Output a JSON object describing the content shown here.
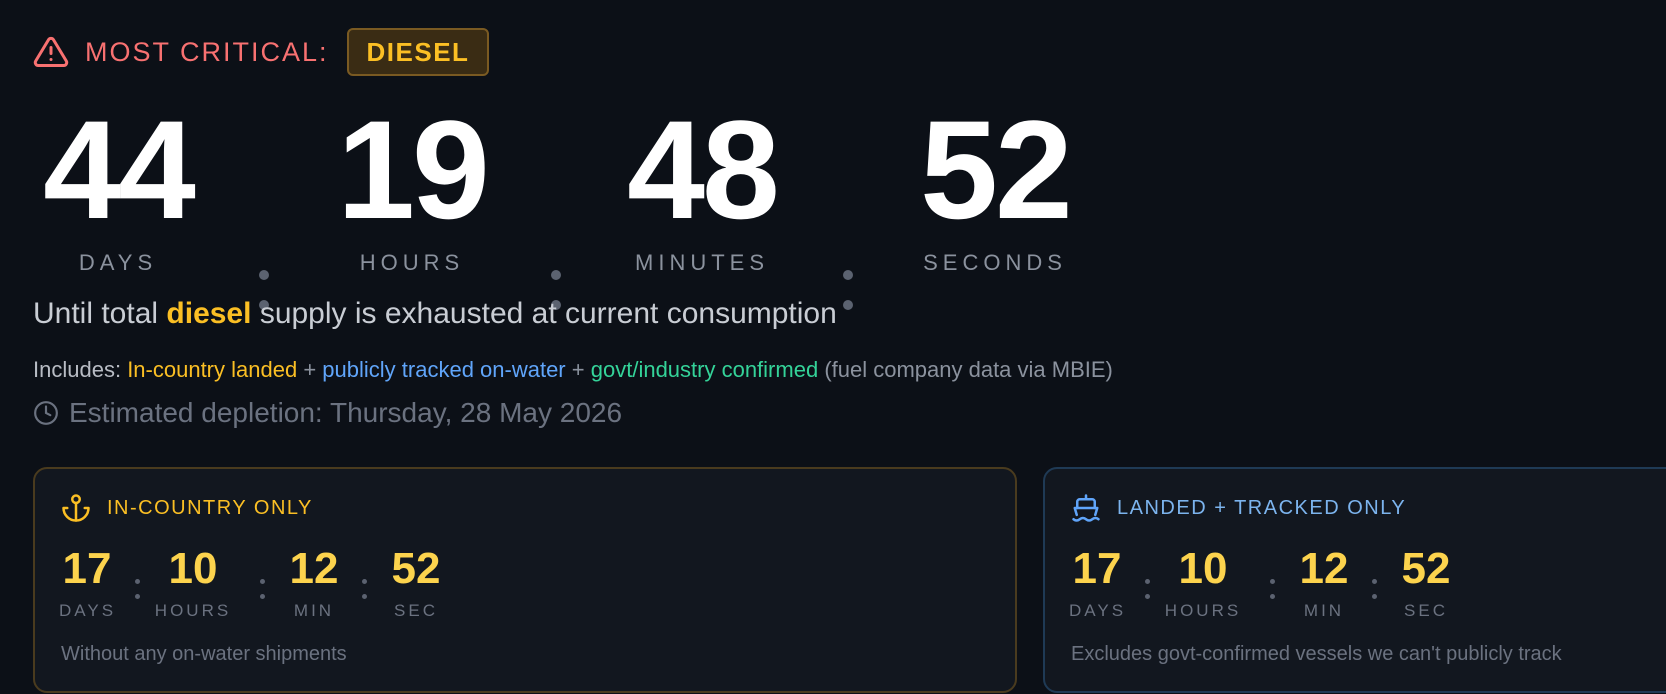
{
  "header": {
    "warning_icon": "alert-triangle-icon",
    "label": "MOST CRITICAL:",
    "fuel_badge": "DIESEL",
    "colors": {
      "critical": "#f87171",
      "badge_text": "#fbbf24"
    }
  },
  "countdown": {
    "days": "44",
    "days_label": "DAYS",
    "hours": "19",
    "hours_label": "HOURS",
    "minutes": "48",
    "minutes_label": "MINUTES",
    "seconds": "52",
    "seconds_label": "SECONDS"
  },
  "until": {
    "prefix": "Until total",
    "fuel": "diesel",
    "suffix": "supply is exhausted at current consumption"
  },
  "includes": {
    "prefix": "Includes:",
    "landed": "In-country landed",
    "plus": "+",
    "tracked": "publicly tracked on-water",
    "confirmed": "govt/industry confirmed",
    "note": "(fuel company data via MBIE)"
  },
  "estimate": {
    "icon": "clock-icon",
    "text": "Estimated depletion: Thursday, 28 May 2026"
  },
  "cards": [
    {
      "icon": "anchor-icon",
      "title": "IN-COUNTRY ONLY",
      "days": "17",
      "days_label": "DAYS",
      "hours": "10",
      "hours_label": "HOURS",
      "min": "12",
      "min_label": "MIN",
      "sec": "52",
      "sec_label": "SEC",
      "note": "Without any on-water shipments"
    },
    {
      "icon": "ship-icon",
      "title": "LANDED + TRACKED ONLY",
      "days": "17",
      "days_label": "DAYS",
      "hours": "10",
      "hours_label": "HOURS",
      "min": "12",
      "min_label": "MIN",
      "sec": "52",
      "sec_label": "SEC",
      "note": "Excludes govt-confirmed vessels we can't publicly track"
    }
  ]
}
